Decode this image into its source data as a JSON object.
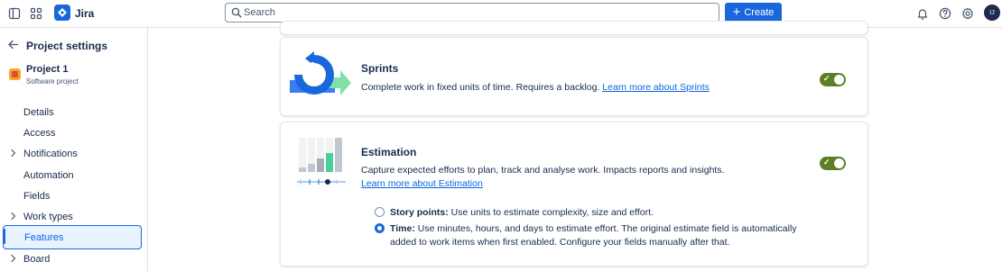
{
  "topbar": {
    "app_name": "Jira",
    "search_placeholder": "Search",
    "create_label": "Create",
    "avatar_initials": "IJ",
    "brand_color": "#1868db"
  },
  "sidebar": {
    "title": "Project settings",
    "project": {
      "name": "Project 1",
      "type": "Software project"
    },
    "items": [
      {
        "label": "Details",
        "has_chevron": false,
        "active": false
      },
      {
        "label": "Access",
        "has_chevron": false,
        "active": false
      },
      {
        "label": "Notifications",
        "has_chevron": true,
        "active": false
      },
      {
        "label": "Automation",
        "has_chevron": false,
        "active": false
      },
      {
        "label": "Fields",
        "has_chevron": false,
        "active": false
      },
      {
        "label": "Work types",
        "has_chevron": true,
        "active": false
      },
      {
        "label": "Features",
        "has_chevron": false,
        "active": true
      },
      {
        "label": "Board",
        "has_chevron": true,
        "active": false
      }
    ]
  },
  "features": {
    "sprints": {
      "title": "Sprints",
      "description": "Complete work in fixed units of time. Requires a backlog. ",
      "link": "Learn more about Sprints",
      "enabled": true
    },
    "estimation": {
      "title": "Estimation",
      "description": "Capture expected efforts to plan, track and analyse work. Impacts reports and insights.",
      "link": "Learn more about Estimation",
      "enabled": true,
      "options": [
        {
          "label": "Story points:",
          "text": " Use units to estimate complexity, size and effort.",
          "selected": false
        },
        {
          "label": "Time:",
          "text": " Use minutes, hours, and days to estimate effort. The original estimate field is automatically",
          "text2": "added to work items when first enabled. Configure your fields manually after that.",
          "selected": true
        }
      ]
    }
  },
  "colors": {
    "toggle_on": "#5b7f24",
    "accent": "#1868db"
  }
}
